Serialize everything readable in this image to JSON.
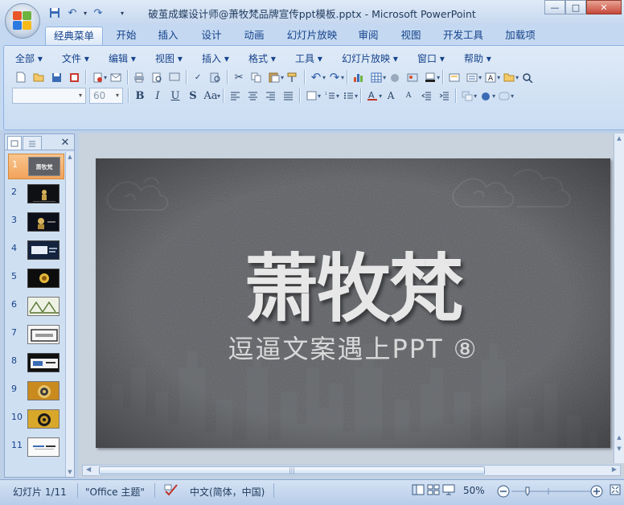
{
  "window": {
    "title": "破茧成蝶设计师@萧牧梵品牌宣传ppt模板.pptx - Microsoft PowerPoint",
    "controls": [
      "—",
      "□",
      "✕"
    ]
  },
  "ribbon_tabs": [
    "经典菜单",
    "开始",
    "插入",
    "设计",
    "动画",
    "幻灯片放映",
    "审阅",
    "视图",
    "开发工具",
    "加载项"
  ],
  "active_tab": "经典菜单",
  "menus": [
    "全部 ▾",
    "文件 ▾",
    "编辑 ▾",
    "视图 ▾",
    "插入 ▾",
    "格式 ▾",
    "工具 ▾",
    "幻灯片放映 ▾",
    "窗口 ▾",
    "帮助 ▾"
  ],
  "toolbar": {
    "font_size": "60",
    "font_name": ""
  },
  "slides_pane": {
    "thumbnails": [
      "1",
      "2",
      "3",
      "4",
      "5",
      "6",
      "7",
      "8",
      "9",
      "10",
      "11"
    ],
    "selected": "1",
    "mini_title": "萧牧梵"
  },
  "slide": {
    "title": "萧牧梵",
    "subtitle": "逗逼文案遇上PPT ⑧",
    "background": "#5a5c60"
  },
  "status_bar": {
    "slide_info": "幻灯片 1/11",
    "theme": "\"Office 主题\"",
    "language": "中文(简体，中国)",
    "zoom": "50%"
  },
  "colors": {
    "ribbon_bg": "#c4d9f1",
    "selected_thumb": "#f2a35c",
    "accent": "#15428b"
  }
}
